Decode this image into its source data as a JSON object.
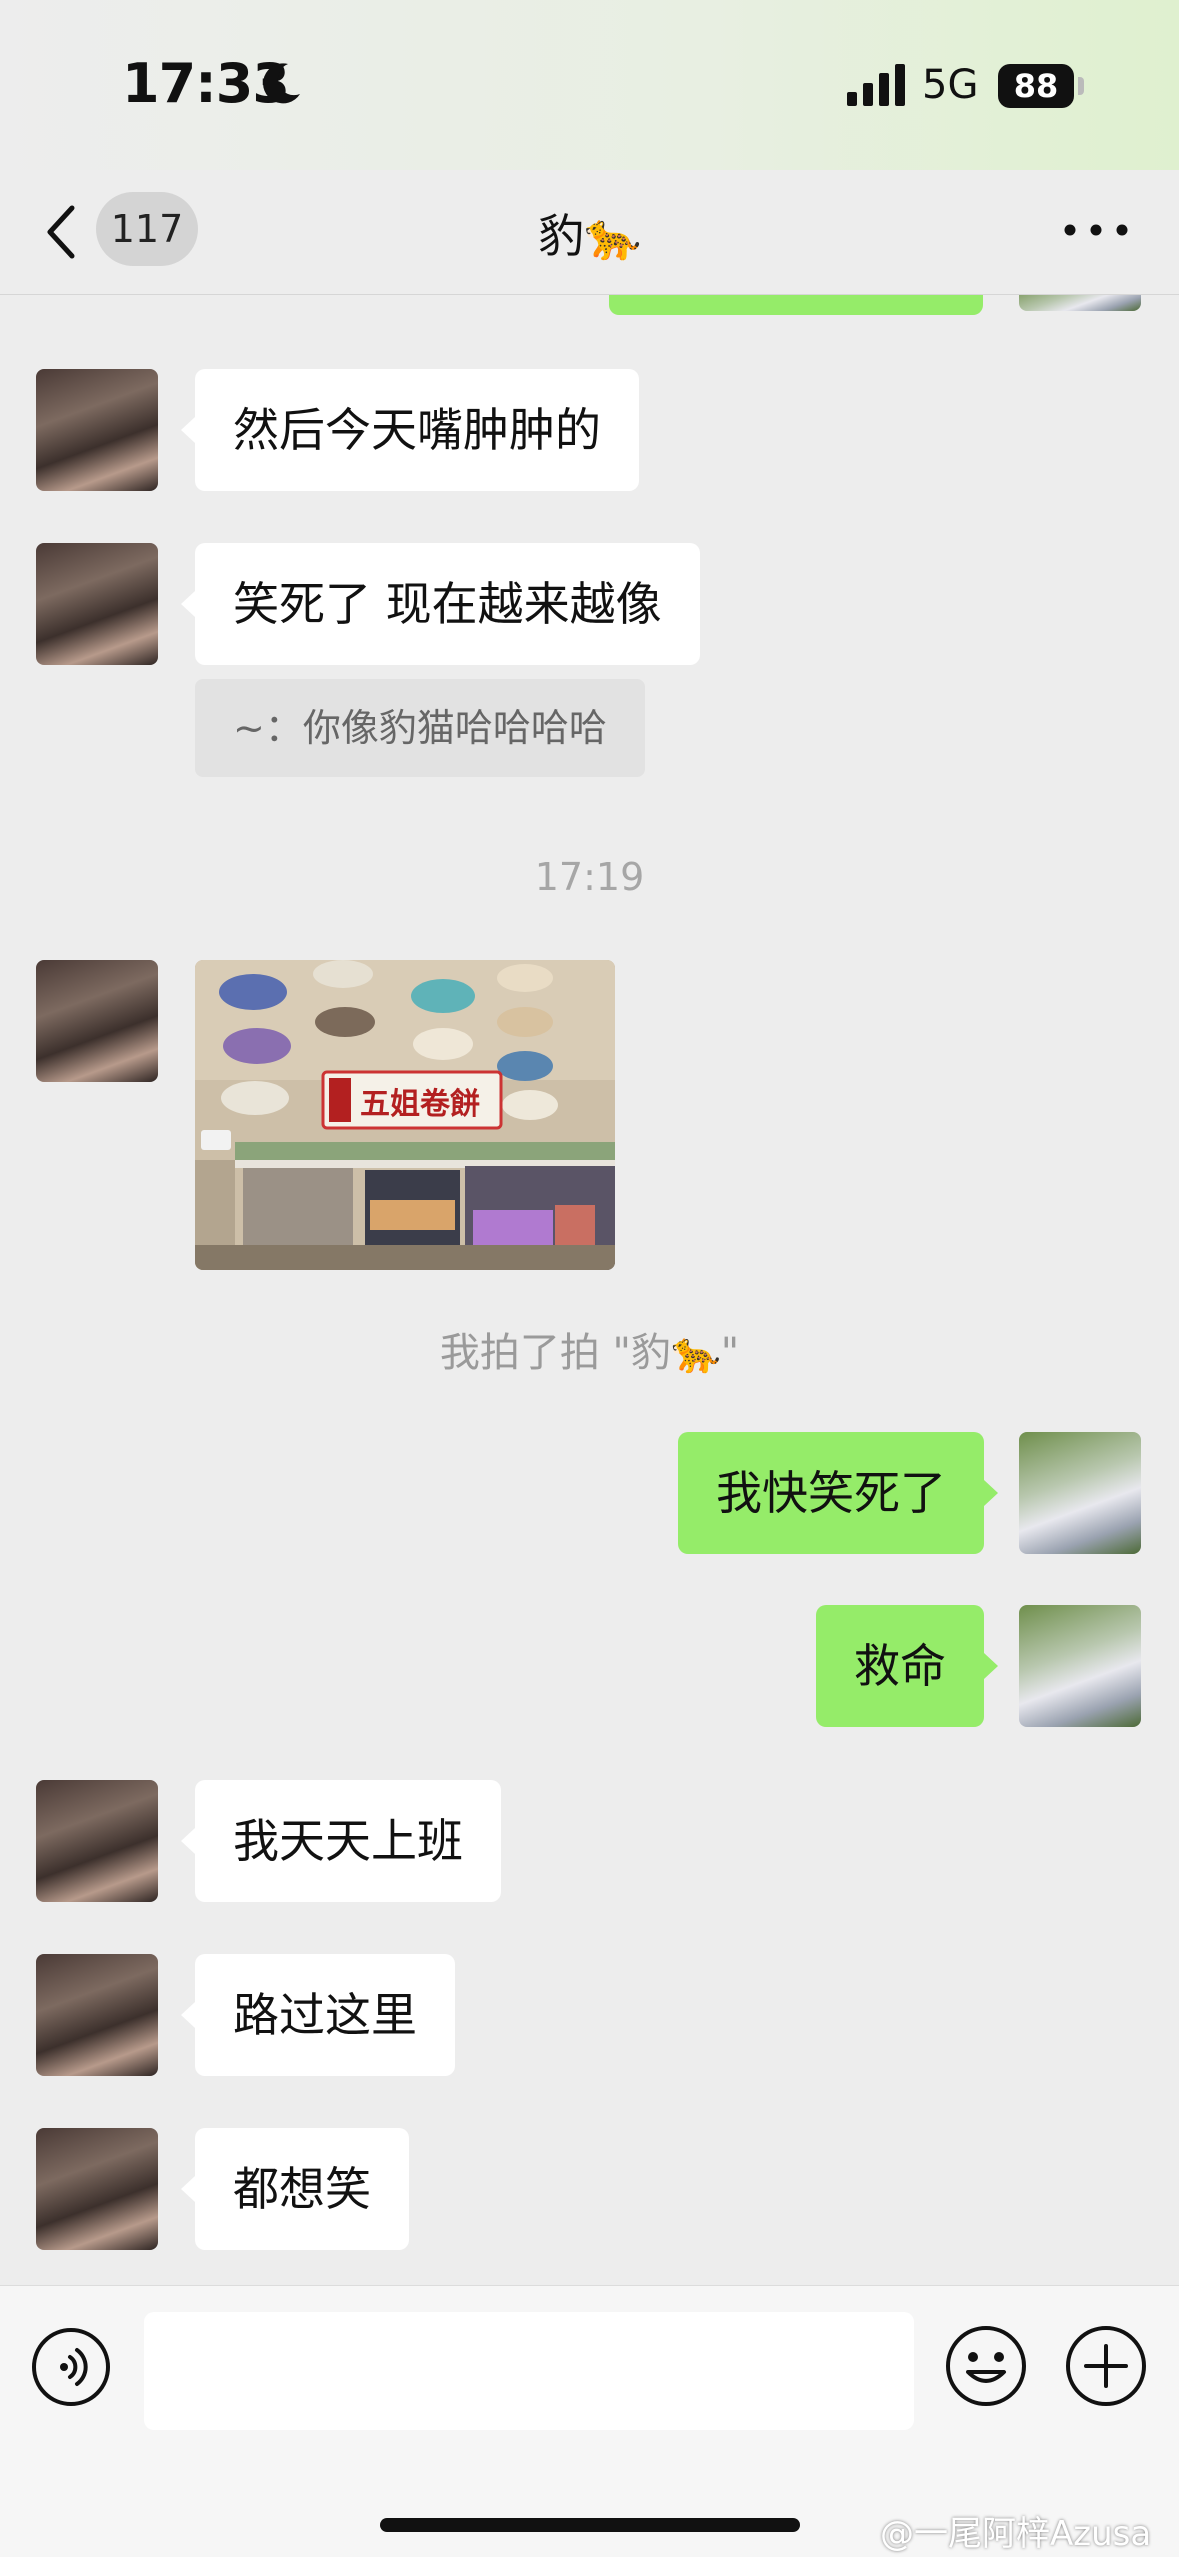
{
  "status_bar": {
    "time": "17:33",
    "network": "5G",
    "battery": "88"
  },
  "nav": {
    "unread_count": "117",
    "title": "豹🐆"
  },
  "messages": [
    {
      "side": "in",
      "text": "然后今天嘴肿肿的"
    },
    {
      "side": "in",
      "text": "笑死了 现在越来越像",
      "quote": "~：你像豹猫哈哈哈哈"
    },
    {
      "timestamp": "17:19"
    },
    {
      "side": "in",
      "type": "image",
      "image_sign": "五姐卷餅"
    },
    {
      "system": "我拍了拍 \"豹🐆\""
    },
    {
      "side": "out",
      "text": "我快笑死了"
    },
    {
      "side": "out",
      "text": "救命"
    },
    {
      "side": "in",
      "text": "我天天上班"
    },
    {
      "side": "in",
      "text": "路过这里"
    },
    {
      "side": "in",
      "text": "都想笑"
    }
  ],
  "watermark": "@一尾阿梓Azusa",
  "colors": {
    "out_bubble": "#95ec69",
    "in_bubble": "#ffffff",
    "background": "#ededed"
  },
  "icons": [
    "moon-icon",
    "signal-icon",
    "back-icon",
    "more-icon",
    "voice-icon",
    "emoji-icon",
    "plus-icon"
  ]
}
